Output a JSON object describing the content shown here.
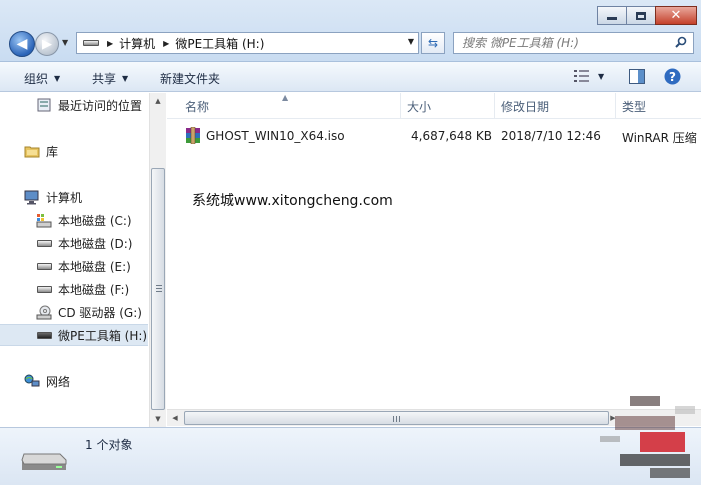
{
  "address": {
    "breadcrumbs": [
      "计算机",
      "微PE工具箱 (H:)"
    ]
  },
  "search": {
    "placeholder": "搜索 微PE工具箱 (H:)"
  },
  "toolbar": {
    "organize": "组织",
    "share": "共享",
    "new_folder": "新建文件夹"
  },
  "nav": {
    "recent": "最近访问的位置",
    "libraries": "库",
    "computer": "计算机",
    "drives": [
      {
        "label": "本地磁盘 (C:)",
        "icon": "system-drive-icon"
      },
      {
        "label": "本地磁盘 (D:)",
        "icon": "hard-drive-icon"
      },
      {
        "label": "本地磁盘 (E:)",
        "icon": "hard-drive-icon"
      },
      {
        "label": "本地磁盘 (F:)",
        "icon": "hard-drive-icon"
      },
      {
        "label": "CD 驱动器 (G:)",
        "icon": "cd-drive-icon"
      },
      {
        "label": "微PE工具箱 (H:)",
        "icon": "usb-drive-icon",
        "selected": true
      }
    ],
    "network": "网络"
  },
  "columns": [
    "名称",
    "大小",
    "修改日期",
    "类型"
  ],
  "files": [
    {
      "name": "GHOST_WIN10_X64.iso",
      "size": "4,687,648 KB",
      "date": "2018/7/10 12:46",
      "type": "WinRAR 压缩"
    }
  ],
  "watermark": "系统城www.xitongcheng.com",
  "status": {
    "count": "1 个对象"
  },
  "colors": {
    "selected": "#dde8f3",
    "header_text": "#4c607a",
    "toolbar_bg": "#dce7f4"
  }
}
